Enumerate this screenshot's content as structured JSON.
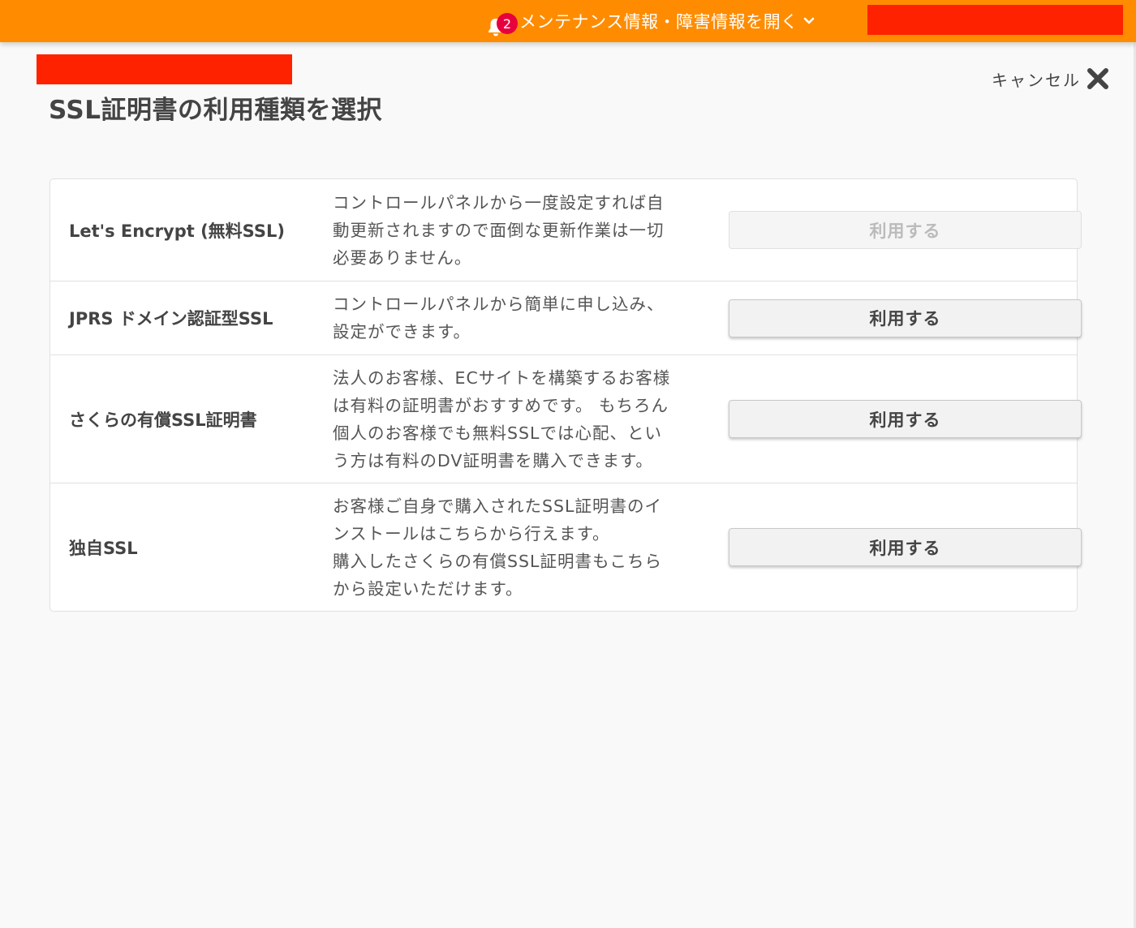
{
  "topbar": {
    "notice_count": "2",
    "notice_label": "メンテナンス情報・障害情報を開く",
    "accent": "#ff8c00",
    "badge_color": "#e8003d",
    "redaction_color": "#ff2200",
    "icons": [
      "bell-icon",
      "chevron-down-icon"
    ]
  },
  "header": {
    "title": "SSL証明書の利用種類を選択",
    "cancel_label": "キャンセル",
    "cancel_icon": "close-icon"
  },
  "options": [
    {
      "name": "Let's Encrypt (無料SSL)",
      "description": "コントロールパネルから一度設定すれば自\n動更新されますので面倒な更新作業は一切\n必要ありません。",
      "button_label": "利用する",
      "button_state": "disabled"
    },
    {
      "name": "JPRS ドメイン認証型SSL",
      "description": "コントロールパネルから簡単に申し込み、\n設定ができます。",
      "button_label": "利用する",
      "button_state": "enabled"
    },
    {
      "name": "さくらの有償SSL証明書",
      "description": "法人のお客様、ECサイトを構築するお客様\nは有料の証明書がおすすめです。 もちろん\n個人のお客様でも無料SSLでは心配、とい\nう方は有料のDV証明書を購入できます。",
      "button_label": "利用する",
      "button_state": "enabled"
    },
    {
      "name": "独自SSL",
      "description": "お客様ご自身で購入されたSSL証明書のイ\nンストールはこちらから行えます。\n購入したさくらの有償SSL証明書もこちら\nから設定いただけます。",
      "button_label": "利用する",
      "button_state": "enabled"
    }
  ]
}
